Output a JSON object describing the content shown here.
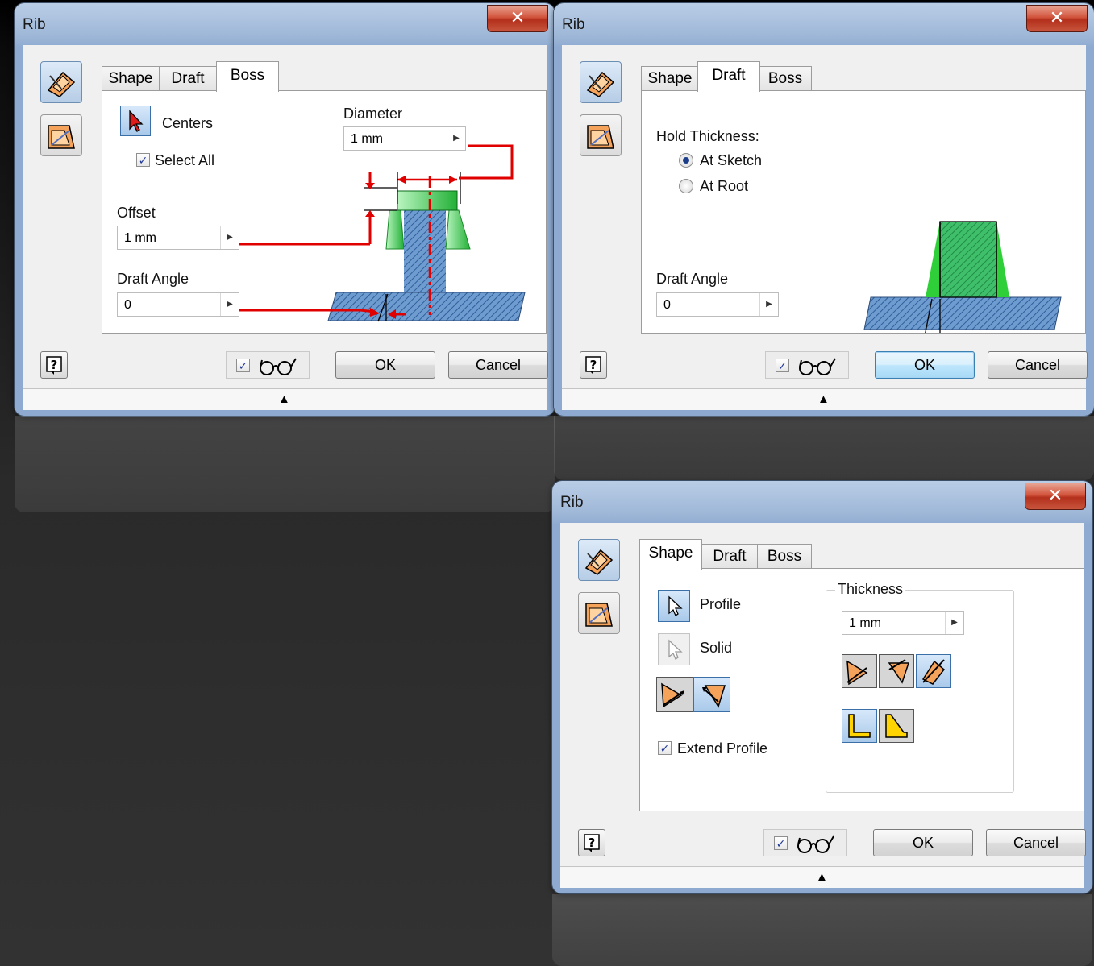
{
  "window_title": "Rib",
  "tabs": [
    "Shape",
    "Draft",
    "Boss"
  ],
  "close_glyph": "✕",
  "footer": {
    "ok": "OK",
    "cancel": "Cancel",
    "help": "?",
    "preview_checked": true
  },
  "boss_tab": {
    "centers_label": "Centers",
    "select_all_label": "Select All",
    "select_all_checked": true,
    "diameter_label": "Diameter",
    "diameter_value": "1 mm",
    "offset_label": "Offset",
    "offset_value": "1 mm",
    "draft_angle_label": "Draft Angle",
    "draft_angle_value": "0"
  },
  "draft_tab": {
    "hold_thickness_label": "Hold Thickness:",
    "options": [
      "At Sketch",
      "At Root"
    ],
    "selected": "At Sketch",
    "draft_angle_label": "Draft Angle",
    "draft_angle_value": "0"
  },
  "shape_tab": {
    "profile_label": "Profile",
    "solid_label": "Solid",
    "thickness_label": "Thickness",
    "thickness_value": "1 mm",
    "extend_profile_label": "Extend Profile",
    "extend_profile_checked": true
  },
  "icons": [
    "rib-feature-icon",
    "web-feature-icon",
    "select-arrow-icon",
    "direction-icon",
    "preview-glasses-icon",
    "help-icon",
    "expand-arrow-icon"
  ],
  "colors": {
    "accent_red": "#e00000",
    "boss_green": "#33cc44",
    "part_blue": "#5b8fc8",
    "title_blue": "#9fb8d8"
  }
}
